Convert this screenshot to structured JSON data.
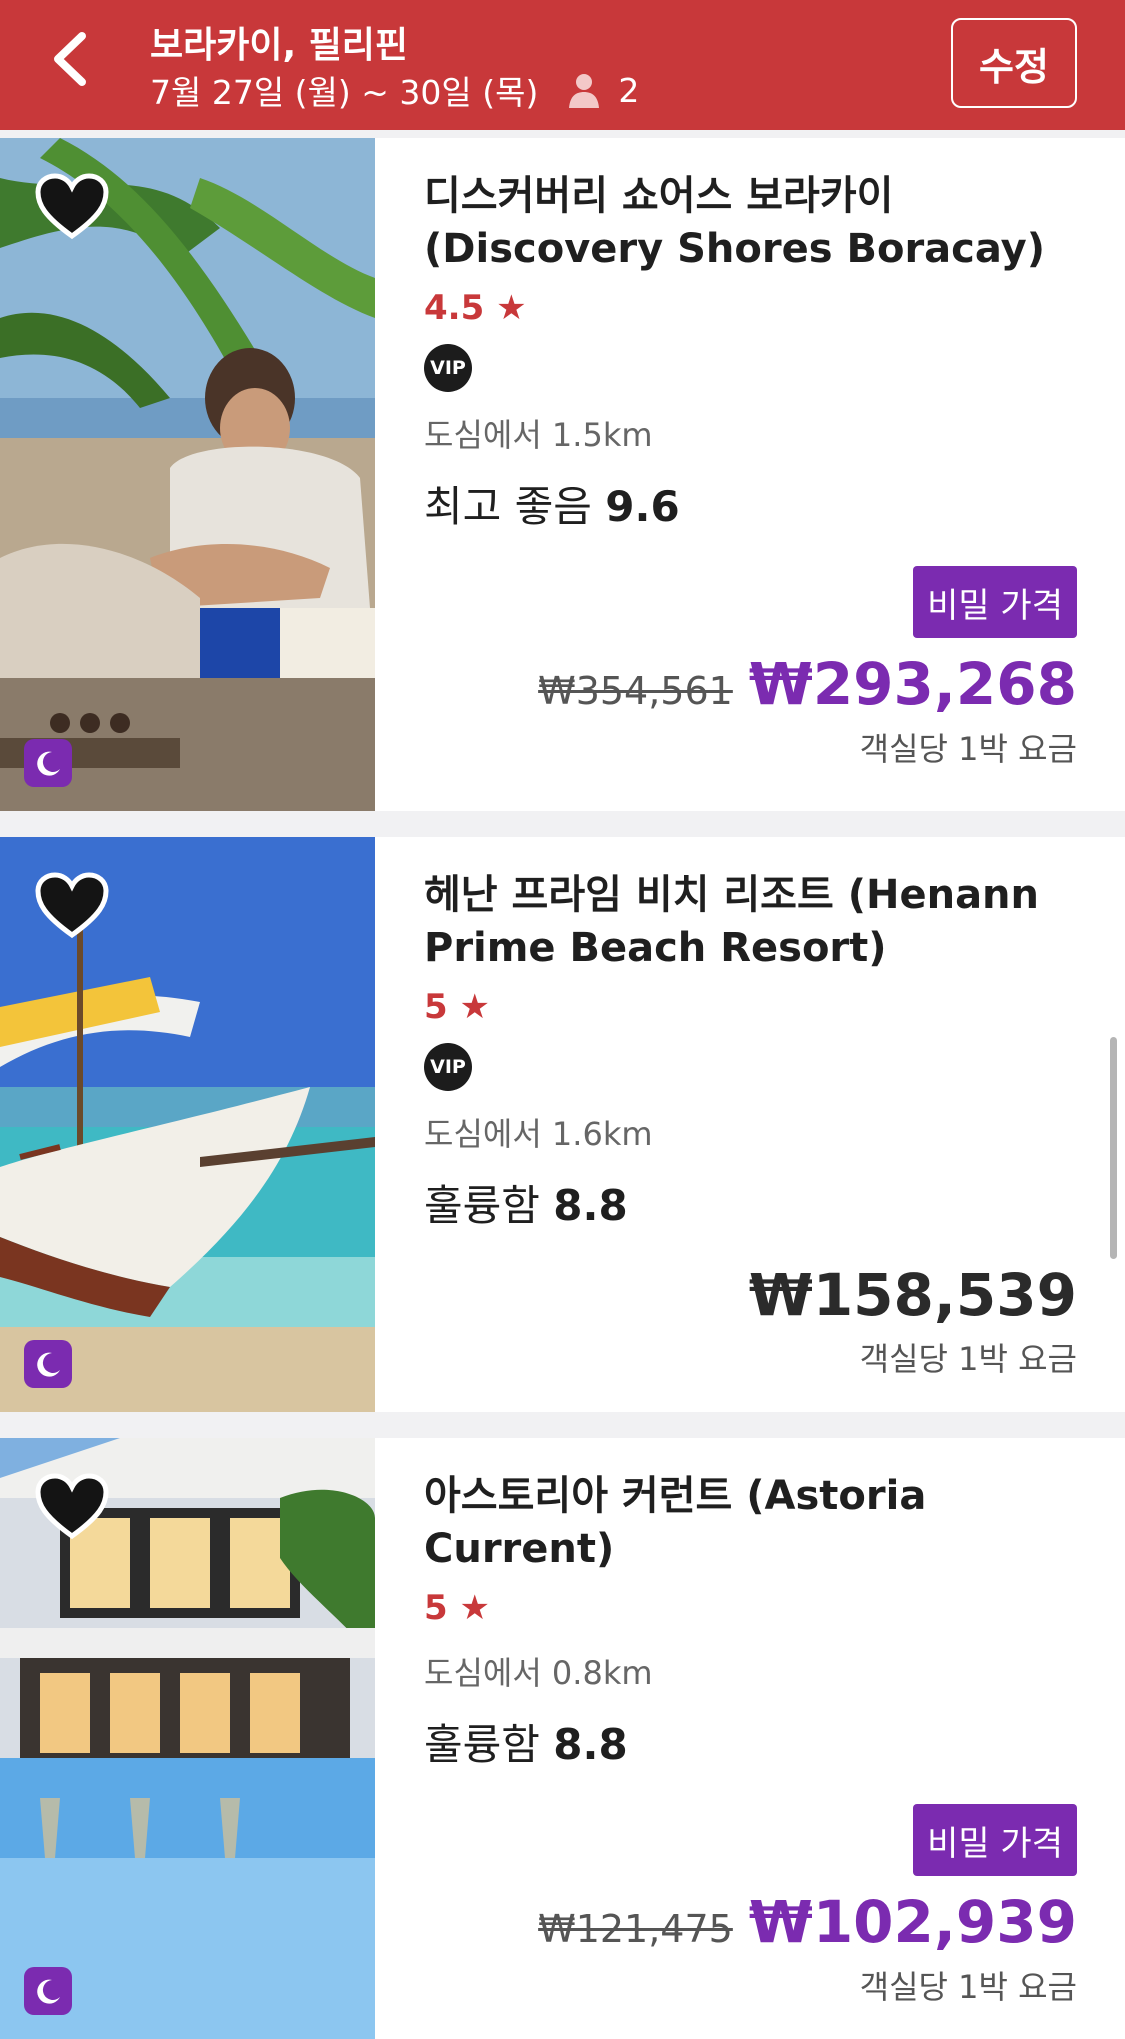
{
  "header": {
    "title": "보라카이, 필리핀",
    "dates": "7월 27일 (월) ~ 30일 (목)",
    "guests": "2",
    "edit_label": "수정",
    "back_icon": "chevron-left-icon",
    "guest_icon": "person-icon"
  },
  "colors": {
    "header_bg": "#c8383a",
    "accent_purple": "#7b2bb0",
    "star_red": "#c8383a"
  },
  "hotels": [
    {
      "name": "디스커버리 쇼어스 보라카이 (Discovery Shores Boracay)",
      "stars": "4.5",
      "vip": "VIP",
      "distance": "도심에서 1.5km",
      "rating_label": "최고 좋음",
      "rating_score": "9.6",
      "secret_label": "비밀 가격",
      "old_price": "₩354,561",
      "price": "₩293,268",
      "per_night": "객실당 1박 요금",
      "favorited": true
    },
    {
      "name": "헤난 프라임 비치 리조트 (Henann Prime Beach Resort)",
      "stars": "5",
      "vip": "VIP",
      "distance": "도심에서 1.6km",
      "rating_label": "훌륭함",
      "rating_score": "8.8",
      "price": "₩158,539",
      "per_night": "객실당 1박 요금",
      "favorited": true
    },
    {
      "name": "아스토리아 커런트 (Astoria Current)",
      "stars": "5",
      "distance": "도심에서 0.8km",
      "rating_label": "훌륭함",
      "rating_score": "8.8",
      "secret_label": "비밀 가격",
      "old_price": "₩121,475",
      "price": "₩102,939",
      "per_night": "객실당 1박 요금",
      "favorited": true
    }
  ]
}
